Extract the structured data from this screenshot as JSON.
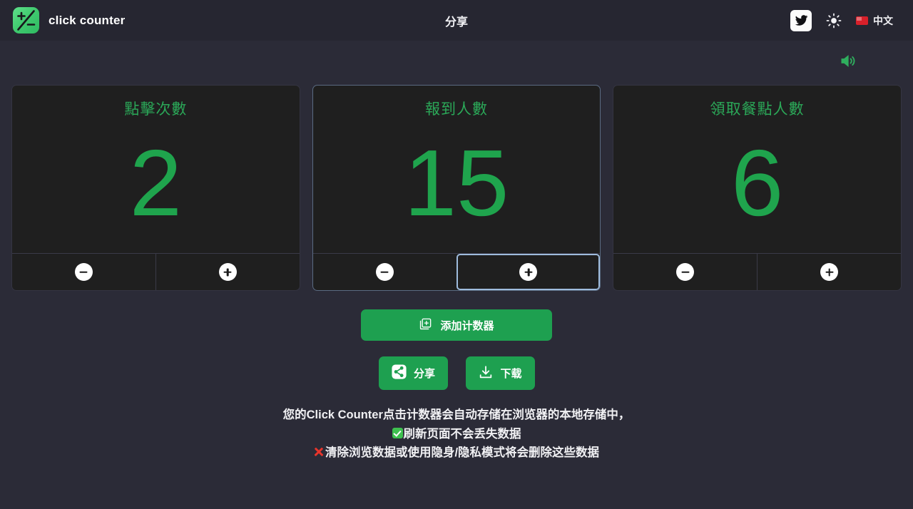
{
  "header": {
    "brand_name": "click counter",
    "logo_icon": "plus-minus-logo-icon",
    "center_title": "分享",
    "twitter_icon": "twitter-icon",
    "theme_icon": "sun-icon",
    "lang_flag_icon": "flag-icon",
    "lang_label": "中文"
  },
  "toolbar": {
    "sound_icon": "speaker-on-icon"
  },
  "counters": [
    {
      "title": "點擊次數",
      "value": "2",
      "decrement_icon": "minus-circle-icon",
      "increment_icon": "plus-circle-icon",
      "focused": false
    },
    {
      "title": "報到人數",
      "value": "15",
      "decrement_icon": "minus-circle-icon",
      "increment_icon": "plus-circle-icon",
      "focused": true
    },
    {
      "title": "領取餐點人數",
      "value": "6",
      "decrement_icon": "minus-circle-icon",
      "increment_icon": "plus-circle-icon",
      "focused": false
    }
  ],
  "actions": {
    "add_label": "添加计数器",
    "add_icon": "add-box-icon",
    "share_label": "分享",
    "share_icon": "share-nodes-icon",
    "download_label": "下载",
    "download_icon": "download-icon"
  },
  "footer": {
    "line1": "您的Click Counter点击计数器会自动存储在浏览器的本地存储中，",
    "line2": "刷新页面不会丢失数据",
    "line2_icon": "check-mark-icon",
    "line3": "清除浏览数据或使用隐身/隐私模式将会删除这些数据",
    "line3_icon": "cross-mark-icon"
  },
  "colors": {
    "background": "#2b2b37",
    "header_background": "#262631",
    "card_background": "#1f1f1f",
    "accent_green": "#1ea050",
    "value_green": "#1fa44d",
    "title_green": "#2ba858",
    "focus_outline": "#9fbcdd",
    "danger_red": "#e8352b"
  }
}
